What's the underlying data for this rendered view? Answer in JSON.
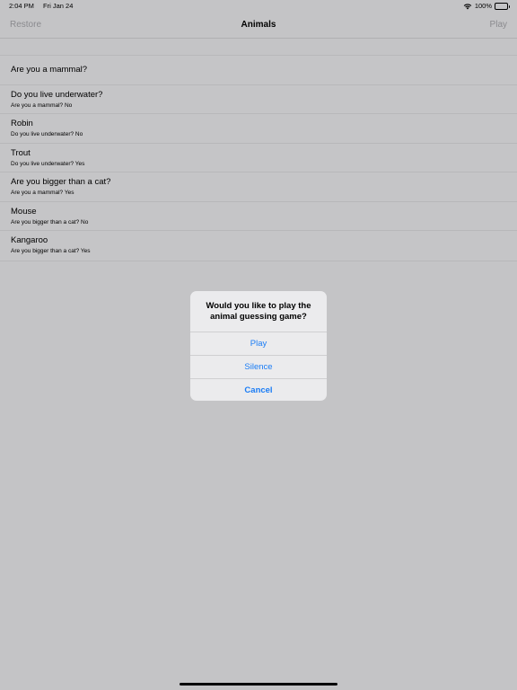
{
  "status_bar": {
    "time": "2:04 PM",
    "date": "Fri Jan 24",
    "battery": "100%"
  },
  "nav": {
    "left_label": "Restore",
    "title": "Animals",
    "right_label": "Play"
  },
  "rows": [
    {
      "title": "Are you a mammal?",
      "subtitle": ""
    },
    {
      "title": "Do you live underwater?",
      "subtitle": "Are you a mammal? No"
    },
    {
      "title": "Robin",
      "subtitle": "Do you live underwater? No"
    },
    {
      "title": "Trout",
      "subtitle": "Do you live underwater? Yes"
    },
    {
      "title": "Are you bigger than a cat?",
      "subtitle": "Are you a mammal? Yes"
    },
    {
      "title": "Mouse",
      "subtitle": "Are you bigger than a cat? No"
    },
    {
      "title": "Kangaroo",
      "subtitle": "Are you bigger than a cat? Yes"
    }
  ],
  "alert": {
    "message": "Would you like to play the animal guessing game?",
    "actions": [
      "Play",
      "Silence",
      "Cancel"
    ]
  },
  "colors": {
    "accent": "#1a7cf5",
    "background": "#c4c4c6"
  }
}
